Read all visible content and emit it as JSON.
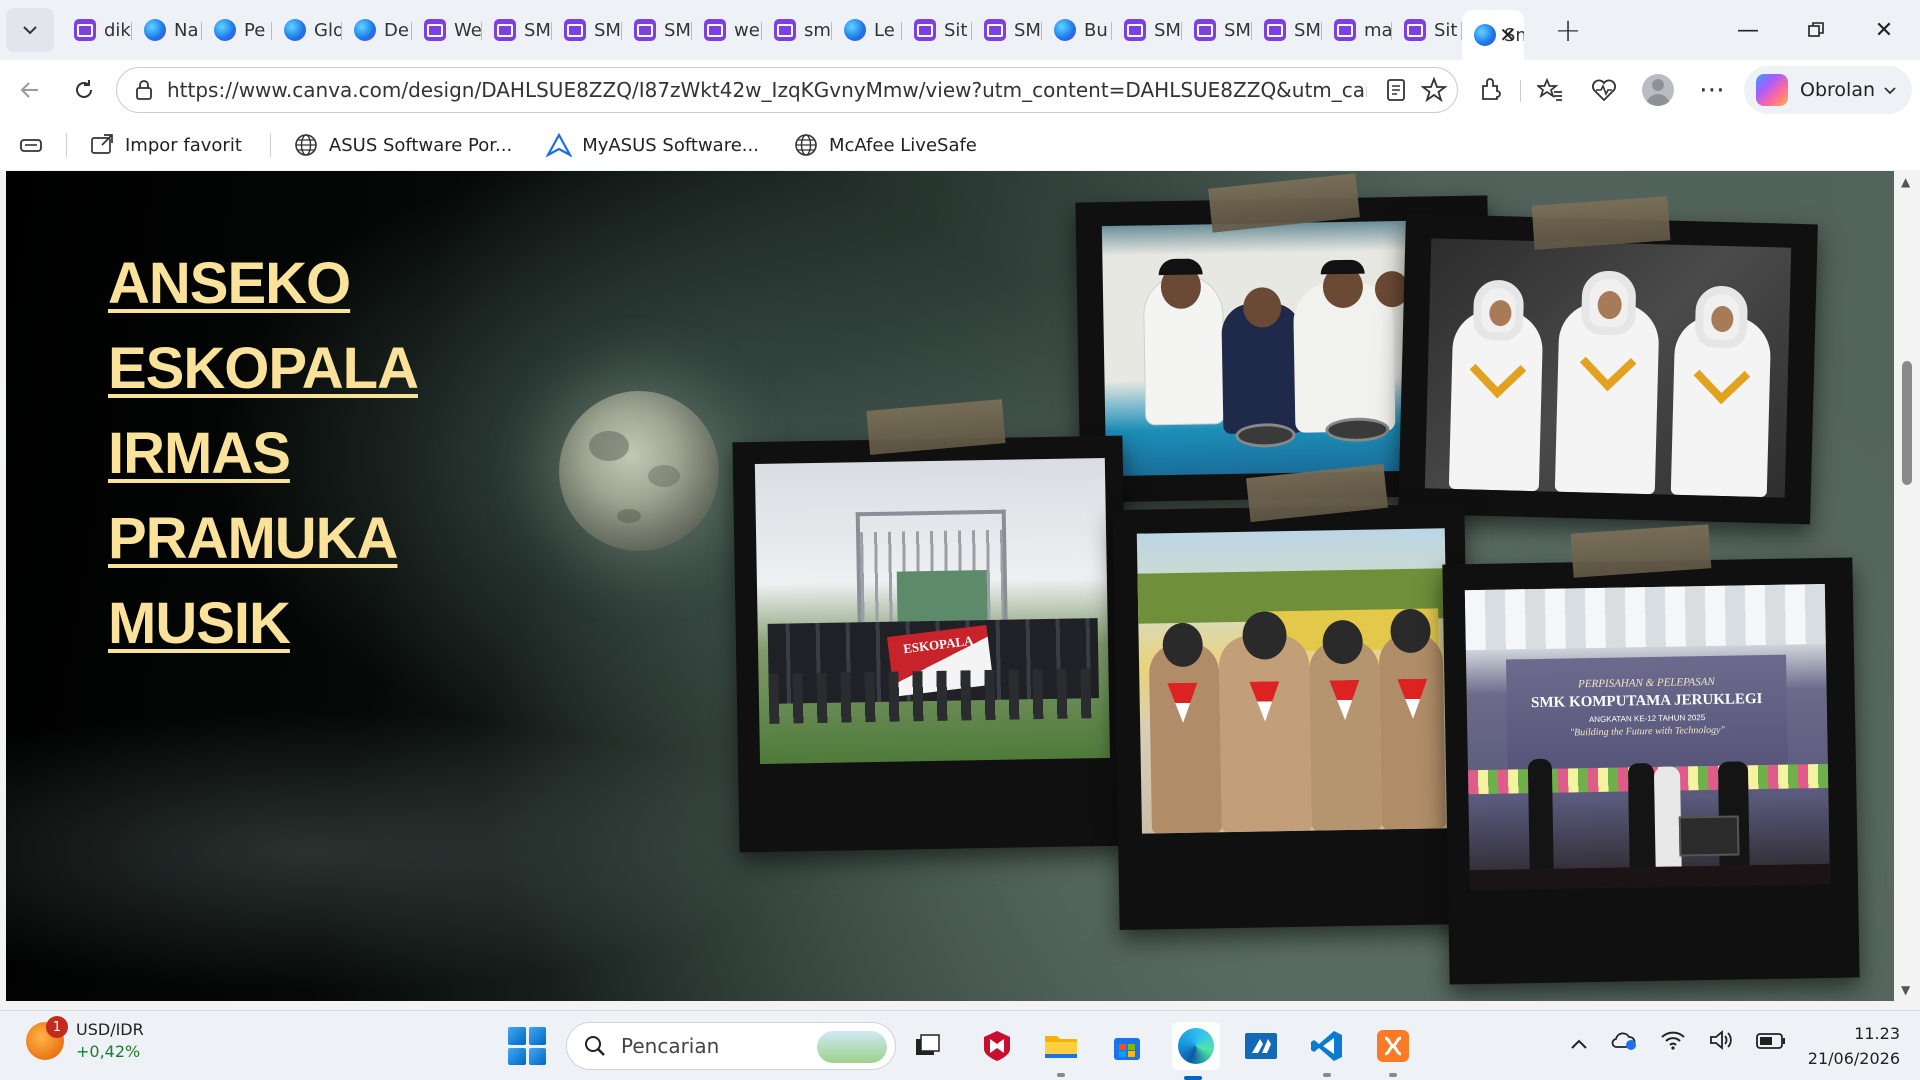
{
  "browser": {
    "tabs": [
      {
        "title": "dik",
        "icon": "canva-icon"
      },
      {
        "title": "Na",
        "icon": "edge-icon"
      },
      {
        "title": "Pe",
        "icon": "edge-icon"
      },
      {
        "title": "Glo",
        "icon": "edge-icon"
      },
      {
        "title": "De",
        "icon": "edge-icon"
      },
      {
        "title": "We",
        "icon": "canva-icon"
      },
      {
        "title": "SM",
        "icon": "canva-icon"
      },
      {
        "title": "SM",
        "icon": "canva-icon"
      },
      {
        "title": "SM",
        "icon": "canva-icon"
      },
      {
        "title": "we",
        "icon": "canva-icon"
      },
      {
        "title": "sm",
        "icon": "canva-icon"
      },
      {
        "title": "Le",
        "icon": "edge-icon"
      },
      {
        "title": "Sit",
        "icon": "canva-icon"
      },
      {
        "title": "SM",
        "icon": "canva-icon"
      },
      {
        "title": "Bu",
        "icon": "edge-icon"
      },
      {
        "title": "SM",
        "icon": "canva-icon"
      },
      {
        "title": "SM",
        "icon": "canva-icon"
      },
      {
        "title": "SM",
        "icon": "canva-icon"
      },
      {
        "title": "ma",
        "icon": "canva-icon"
      },
      {
        "title": "Sit",
        "icon": "canva-icon"
      },
      {
        "title": "Sn",
        "icon": "edge-icon"
      }
    ],
    "url": "https://www.canva.com/design/DAHLSUE8ZZQ/I87zWkt42w_IzqKGvnyMmw/view?utm_content=DAHLSUE8ZZQ&utm_campaign...",
    "copilot_label": "Obrolan",
    "favorites": [
      {
        "label": "Impor favorit",
        "icon": "import-icon"
      },
      {
        "label": "ASUS Software Por...",
        "icon": "globe-icon"
      },
      {
        "label": "MyASUS Software...",
        "icon": "asus-icon"
      },
      {
        "label": "McAfee LiveSafe",
        "icon": "globe-icon"
      }
    ]
  },
  "page": {
    "menu": [
      "ANSEKO",
      "ESKOPALA",
      "IRMAS",
      "PRAMUKA",
      "MUSIK"
    ],
    "photo_texts": {
      "banner": "ESKOPALA",
      "stage_line1": "PERPISAHAN & PELEPASAN",
      "stage_line2": "SMK KOMPUTAMA JERUKLEGI",
      "stage_line3": "ANGKATAN KE-12 TAHUN 2025",
      "stage_line4": "\"Building the Future with Technology\""
    },
    "colors": {
      "menu_text": "#fbe29a",
      "background_dark": "#000000",
      "background_light": "#53645c"
    }
  },
  "taskbar": {
    "widget_title": "USD/IDR",
    "widget_change": "+0,42%",
    "widget_badge": "1",
    "search_placeholder": "Pencarian",
    "time": "11.23",
    "date": "21/06/2026"
  }
}
